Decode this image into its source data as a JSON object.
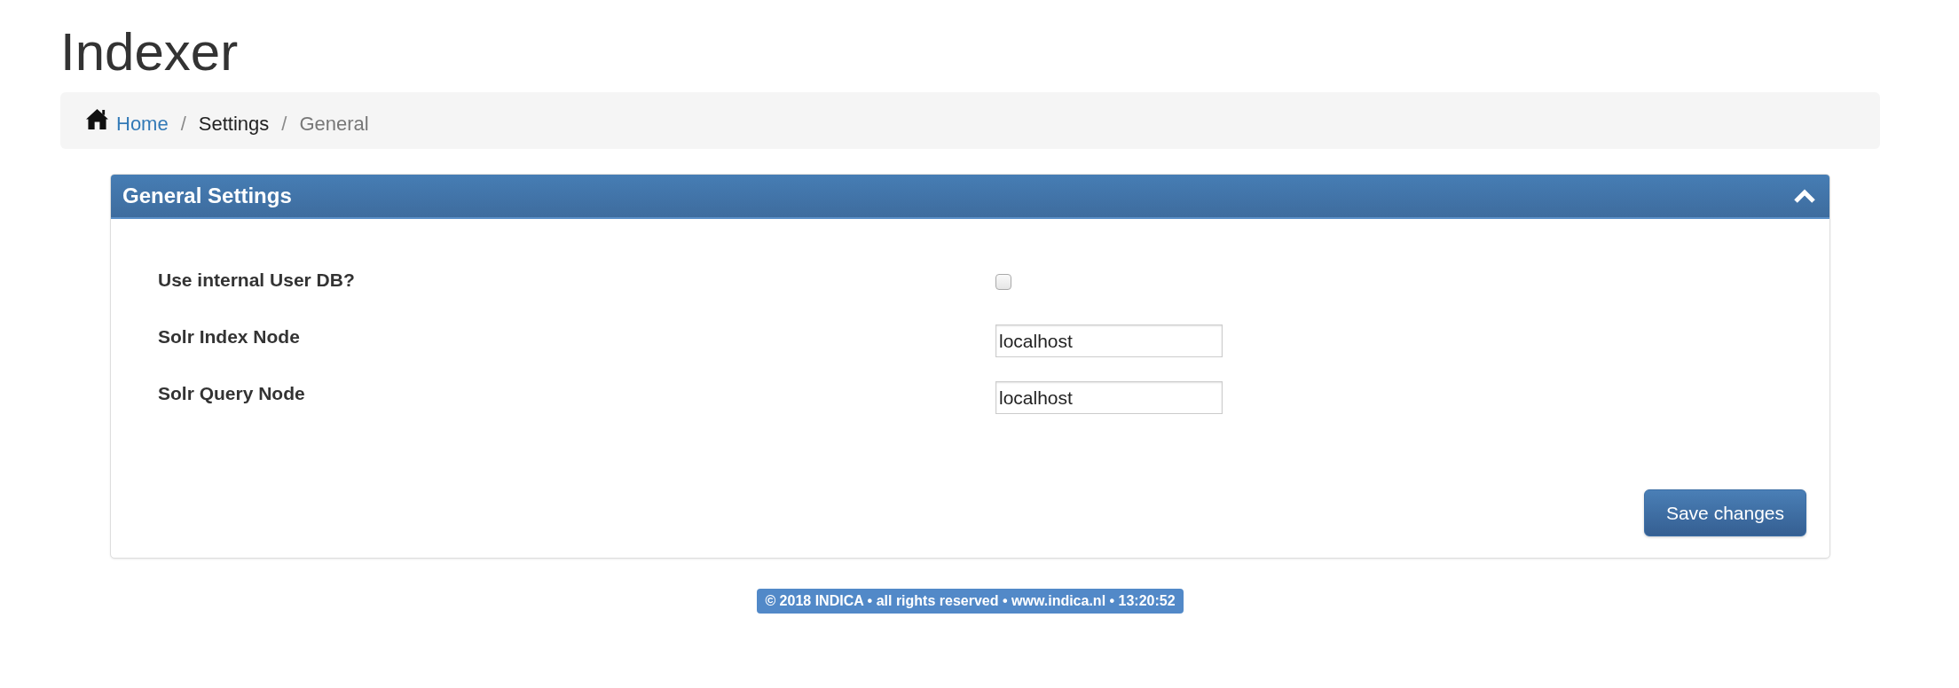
{
  "page": {
    "title": "Indexer"
  },
  "breadcrumb": [
    {
      "label": "Home",
      "kind": "home"
    },
    {
      "label": "/",
      "kind": "separator"
    },
    {
      "label": "Settings",
      "kind": "text"
    },
    {
      "label": "/",
      "kind": "separator"
    },
    {
      "label": "General",
      "kind": "current"
    }
  ],
  "panel": {
    "title": "General Settings",
    "expanded": true,
    "fields": [
      {
        "label": "Use internal User DB?",
        "kind": "checkbox",
        "checked": false
      },
      {
        "label": "Solr Index Node",
        "kind": "text",
        "value": "localhost"
      },
      {
        "label": "Solr Query Node",
        "kind": "text",
        "value": "localhost"
      }
    ],
    "buttons": [
      {
        "label": "Save changes"
      }
    ]
  },
  "footer": {
    "text": "© 2018 INDICA • all rights reserved • www.indica.nl • 13:20:52"
  }
}
